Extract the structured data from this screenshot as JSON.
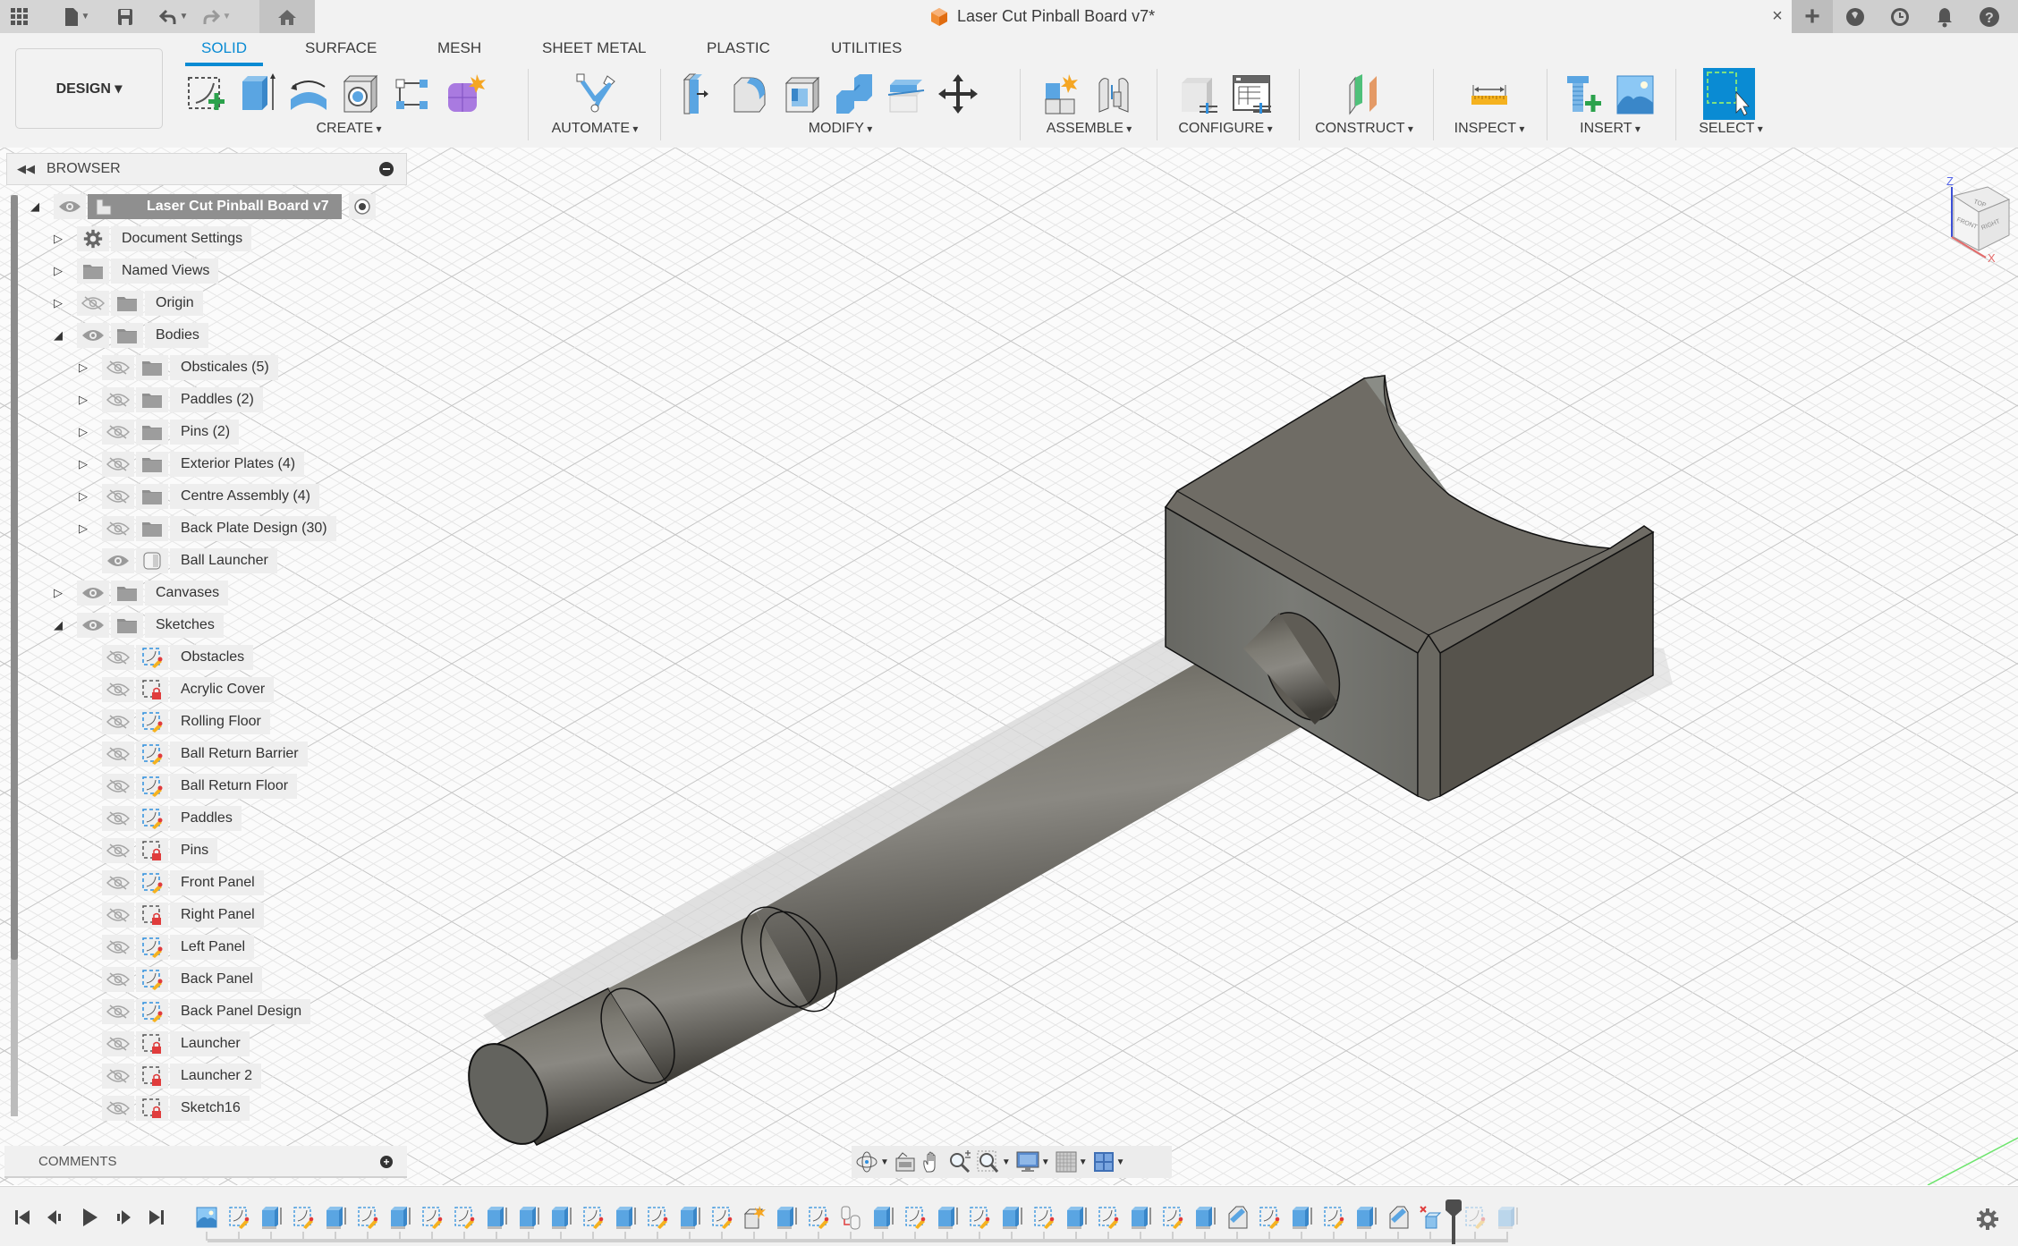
{
  "window": {
    "document_title": "Laser Cut Pinball Board v7*",
    "quick_access": [
      {
        "icon": "app-grid-icon"
      },
      {
        "icon": "file-icon",
        "dropdown": true
      },
      {
        "icon": "save-icon"
      },
      {
        "icon": "undo-icon",
        "dropdown": true
      },
      {
        "icon": "redo-icon",
        "dropdown": true
      },
      {
        "icon": "home-icon"
      }
    ],
    "close_label": "×",
    "right_icons": [
      "new-tab-plus-icon",
      "extensions-icon",
      "job-status-clock-icon",
      "notifications-bell-icon",
      "help-icon"
    ]
  },
  "ribbon": {
    "workspace_button": "DESIGN ▾",
    "tabs": [
      {
        "label": "SOLID",
        "active": true
      },
      {
        "label": "SURFACE",
        "active": false
      },
      {
        "label": "MESH",
        "active": false
      },
      {
        "label": "SHEET METAL",
        "active": false
      },
      {
        "label": "PLASTIC",
        "active": false
      },
      {
        "label": "UTILITIES",
        "active": false
      }
    ],
    "groups": [
      {
        "label": "CREATE",
        "tools": [
          "create-sketch-icon",
          "extrude-icon",
          "revolve-icon",
          "hole-icon",
          "pattern-icon",
          "create-form-icon"
        ]
      },
      {
        "label": "AUTOMATE",
        "tools": [
          "automate-icon"
        ]
      },
      {
        "label": "MODIFY",
        "tools": [
          "press-pull-icon",
          "fillet-icon",
          "shell-icon",
          "combine-icon",
          "offset-face-icon",
          "move-icon"
        ]
      },
      {
        "label": "ASSEMBLE",
        "tools": [
          "new-component-icon",
          "joint-icon"
        ]
      },
      {
        "label": "CONFIGURE",
        "tools": [
          "configure-icon",
          "configuration-table-icon"
        ]
      },
      {
        "label": "CONSTRUCT",
        "tools": [
          "offset-plane-icon"
        ]
      },
      {
        "label": "INSPECT",
        "tools": [
          "measure-icon"
        ]
      },
      {
        "label": "INSERT",
        "tools": [
          "insert-mcmaster-icon",
          "insert-canvas-icon"
        ]
      },
      {
        "label": "SELECT",
        "tools": [
          "window-select-icon"
        ]
      }
    ]
  },
  "browser": {
    "title": "BROWSER",
    "root": {
      "label": "Laser Cut Pinball Board v7",
      "expanded": true,
      "visible": true
    },
    "items": [
      {
        "label": "Document Settings",
        "level": 1,
        "expander": "collapsed",
        "type": "settings",
        "visibility": null
      },
      {
        "label": "Named Views",
        "level": 1,
        "expander": "collapsed",
        "type": "folder",
        "visibility": null
      },
      {
        "label": "Origin",
        "level": 1,
        "expander": "collapsed",
        "type": "folder",
        "visibility": "hidden"
      },
      {
        "label": "Bodies",
        "level": 1,
        "expander": "expanded",
        "type": "folder",
        "visibility": "visible"
      },
      {
        "label": "Obsticales (5)",
        "level": 2,
        "expander": "collapsed",
        "type": "folder",
        "visibility": "hidden"
      },
      {
        "label": "Paddles (2)",
        "level": 2,
        "expander": "collapsed",
        "type": "folder",
        "visibility": "hidden"
      },
      {
        "label": "Pins (2)",
        "level": 2,
        "expander": "collapsed",
        "type": "folder",
        "visibility": "hidden"
      },
      {
        "label": "Exterior Plates (4)",
        "level": 2,
        "expander": "collapsed",
        "type": "folder",
        "visibility": "hidden"
      },
      {
        "label": "Centre Assembly (4)",
        "level": 2,
        "expander": "collapsed",
        "type": "folder",
        "visibility": "hidden"
      },
      {
        "label": "Back Plate Design (30)",
        "level": 2,
        "expander": "collapsed",
        "type": "folder",
        "visibility": "hidden"
      },
      {
        "label": "Ball Launcher",
        "level": 2,
        "expander": null,
        "type": "body",
        "visibility": "visible"
      },
      {
        "label": "Canvases",
        "level": 1,
        "expander": "collapsed",
        "type": "folder",
        "visibility": "visible"
      },
      {
        "label": "Sketches",
        "level": 1,
        "expander": "expanded",
        "type": "folder",
        "visibility": "visible"
      },
      {
        "label": "Obstacles",
        "level": 2,
        "expander": null,
        "type": "sketch",
        "visibility": "hidden"
      },
      {
        "label": "Acrylic Cover",
        "level": 2,
        "expander": null,
        "type": "sketch-locked",
        "visibility": "hidden"
      },
      {
        "label": "Rolling Floor",
        "level": 2,
        "expander": null,
        "type": "sketch",
        "visibility": "hidden"
      },
      {
        "label": "Ball Return Barrier",
        "level": 2,
        "expander": null,
        "type": "sketch",
        "visibility": "hidden"
      },
      {
        "label": "Ball Return Floor",
        "level": 2,
        "expander": null,
        "type": "sketch",
        "visibility": "hidden"
      },
      {
        "label": "Paddles",
        "level": 2,
        "expander": null,
        "type": "sketch",
        "visibility": "hidden"
      },
      {
        "label": "Pins",
        "level": 2,
        "expander": null,
        "type": "sketch-locked",
        "visibility": "hidden"
      },
      {
        "label": "Front Panel",
        "level": 2,
        "expander": null,
        "type": "sketch",
        "visibility": "hidden"
      },
      {
        "label": "Right Panel",
        "level": 2,
        "expander": null,
        "type": "sketch-locked",
        "visibility": "hidden"
      },
      {
        "label": "Left Panel",
        "level": 2,
        "expander": null,
        "type": "sketch",
        "visibility": "hidden"
      },
      {
        "label": "Back Panel",
        "level": 2,
        "expander": null,
        "type": "sketch",
        "visibility": "hidden"
      },
      {
        "label": "Back Panel Design",
        "level": 2,
        "expander": null,
        "type": "sketch",
        "visibility": "hidden"
      },
      {
        "label": "Launcher",
        "level": 2,
        "expander": null,
        "type": "sketch-locked",
        "visibility": "hidden"
      },
      {
        "label": "Launcher 2",
        "level": 2,
        "expander": null,
        "type": "sketch-locked",
        "visibility": "hidden"
      },
      {
        "label": "Sketch16",
        "level": 2,
        "expander": null,
        "type": "sketch-locked",
        "visibility": "hidden"
      }
    ]
  },
  "comments": {
    "title": "COMMENTS"
  },
  "navigation_bar": {
    "tools": [
      {
        "icon": "orbit-icon",
        "dropdown": true
      },
      {
        "icon": "look-at-icon",
        "dropdown": false
      },
      {
        "icon": "pan-hand-icon",
        "dropdown": false
      },
      {
        "icon": "zoom-icon",
        "dropdown": false
      },
      {
        "icon": "fit-window-zoom-icon",
        "dropdown": true
      },
      {
        "icon": "display-settings-icon",
        "dropdown": true
      },
      {
        "icon": "grid-settings-icon",
        "dropdown": true
      },
      {
        "icon": "viewports-icon",
        "dropdown": true
      }
    ]
  },
  "view_cube": {
    "faces": [
      "TOP",
      "FRONT",
      "RIGHT"
    ],
    "axes": [
      "Z",
      "X"
    ]
  },
  "timeline": {
    "controls": [
      "go-to-start",
      "step-back",
      "play",
      "step-forward",
      "go-to-end"
    ],
    "features": [
      "canvas",
      "sketch",
      "extrude",
      "sketch",
      "extrude",
      "sketch",
      "extrude",
      "sketch",
      "sketch",
      "extrude",
      "extrude",
      "extrude",
      "sketch",
      "extrude",
      "sketch",
      "extrude",
      "sketch",
      "new-component",
      "extrude",
      "sketch",
      "joint",
      "extrude",
      "sketch",
      "extrude",
      "sketch",
      "extrude",
      "sketch",
      "extrude",
      "sketch",
      "extrude",
      "sketch",
      "extrude",
      "split",
      "sketch",
      "extrude",
      "sketch",
      "extrude",
      "split",
      "delete-body",
      "sketch",
      "extrude"
    ],
    "marker_after_index": 38,
    "suppressed_after_marker": true
  },
  "colors": {
    "accent": "#0a8bd3",
    "body_top": "#6f6c65",
    "body_side_left": "#74756f",
    "body_side_right": "#56534c",
    "shaft": "#605d56"
  }
}
